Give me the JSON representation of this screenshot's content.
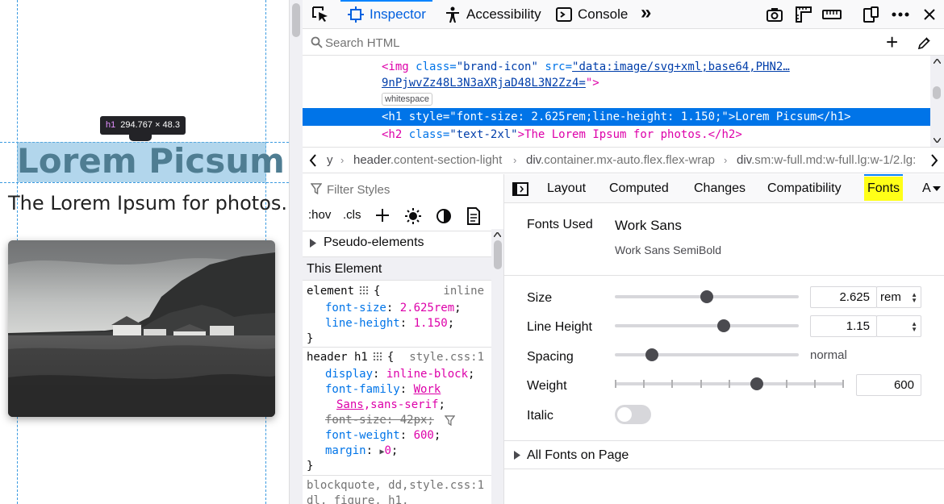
{
  "preview": {
    "hero_title": "Lorem Picsum",
    "hero_subtitle": "The Lorem Ipsum for photos.",
    "infobar_tag": "h1",
    "infobar_dims": "294.767 × 48.3"
  },
  "toolbar": {
    "tabs": [
      {
        "label": "Inspector",
        "icon": "inspector-icon",
        "active": true
      },
      {
        "label": "Accessibility",
        "icon": "accessibility-icon"
      },
      {
        "label": "Console",
        "icon": "console-icon"
      }
    ],
    "more_tabs_glyph": "»",
    "right_icons": [
      "screenshot-icon",
      "rulers-icon",
      "measure-icon",
      "responsive-icon",
      "more-icon",
      "close-icon"
    ],
    "accent_color": "#0a84ff"
  },
  "search": {
    "placeholder": "Search HTML",
    "add_glyph": "+",
    "picker_icon": "eyedropper-icon"
  },
  "markup": {
    "img_tag": "<img",
    "img_class_attr": "class=",
    "img_class_value": "\"brand-icon\"",
    "img_src_attr": "src=",
    "img_src_value": "\"data:image/svg+xml;base64,PHN2…",
    "img_src_cont": "9nPjwvZz48L3N3aXRjaD48L3N2Zz4=",
    "img_end": "\">",
    "whitespace_badge": "whitespace",
    "h1_line": "<h1 style=\"font-size: 2.625rem;line-height: 1.150;\">Lorem Picsum</h1>",
    "h2_tag": "<h2",
    "h2_class_attr": "class=",
    "h2_class_value": "\"text-2xl\"",
    "h2_rest": ">The Lorem Ipsum for photos.</h2>",
    "selected_color": "#0074e8"
  },
  "breadcrumbs": {
    "items": [
      {
        "tag": "y",
        "cls": ""
      },
      {
        "tag": "header",
        "cls": ".content-section-light"
      },
      {
        "tag": "div",
        "cls": ".container.mx-auto.flex.flex-wrap"
      },
      {
        "tag": "div",
        "cls": ".sm:w-full.md:w-full.lg:w-1/2.lg:"
      }
    ]
  },
  "rules": {
    "filter_placeholder": "Filter Styles",
    "hov": ":hov",
    "cls": ".cls",
    "pseudo_elements": "Pseudo-elements",
    "this_element": "This Element",
    "element_rule": {
      "selector": "element",
      "brace": "{",
      "source": "inline",
      "decls": [
        {
          "prop": "font-size",
          "value": "2.625rem"
        },
        {
          "prop": "line-height",
          "value": "1.150"
        }
      ]
    },
    "header_rule": {
      "selector": "header h1",
      "brace": "{",
      "source": "style.css:1",
      "display": {
        "prop": "display",
        "value": "inline-block"
      },
      "font_family": {
        "prop": "font-family",
        "value_1": "Work",
        "value_2": "Sans",
        "value_3": ",sans-serif"
      },
      "font_size_over": "font-size: 42px;",
      "font_weight": {
        "prop": "font-weight",
        "value": "600"
      },
      "margin": {
        "prop": "margin",
        "value": "0"
      }
    },
    "close_brace": "}",
    "next_selector_1": "blockquote, dd,",
    "next_source": "style.css:1",
    "next_selector_2": "dl, figure, h1,"
  },
  "sidebar": {
    "tabs": [
      "Layout",
      "Computed",
      "Changes",
      "Compatibility",
      "Fonts",
      "A"
    ],
    "active_tab": "Fonts",
    "highlight_color": "#ffff17",
    "fonts_used_label": "Fonts Used",
    "font_name": "Work Sans",
    "font_face": "Work Sans SemiBold",
    "size_label": "Size",
    "size_value": "2.625",
    "size_unit": "rem",
    "size_level": 0.5,
    "line_height_label": "Line Height",
    "line_height_value": "1.15",
    "line_height_level": 0.59,
    "spacing_label": "Spacing",
    "spacing_value": "normal",
    "spacing_level": 0.2,
    "weight_label": "Weight",
    "weight_value": "600",
    "weight_level": 0.62,
    "italic_label": "Italic",
    "italic_on": false,
    "all_fonts_label": "All Fonts on Page"
  }
}
